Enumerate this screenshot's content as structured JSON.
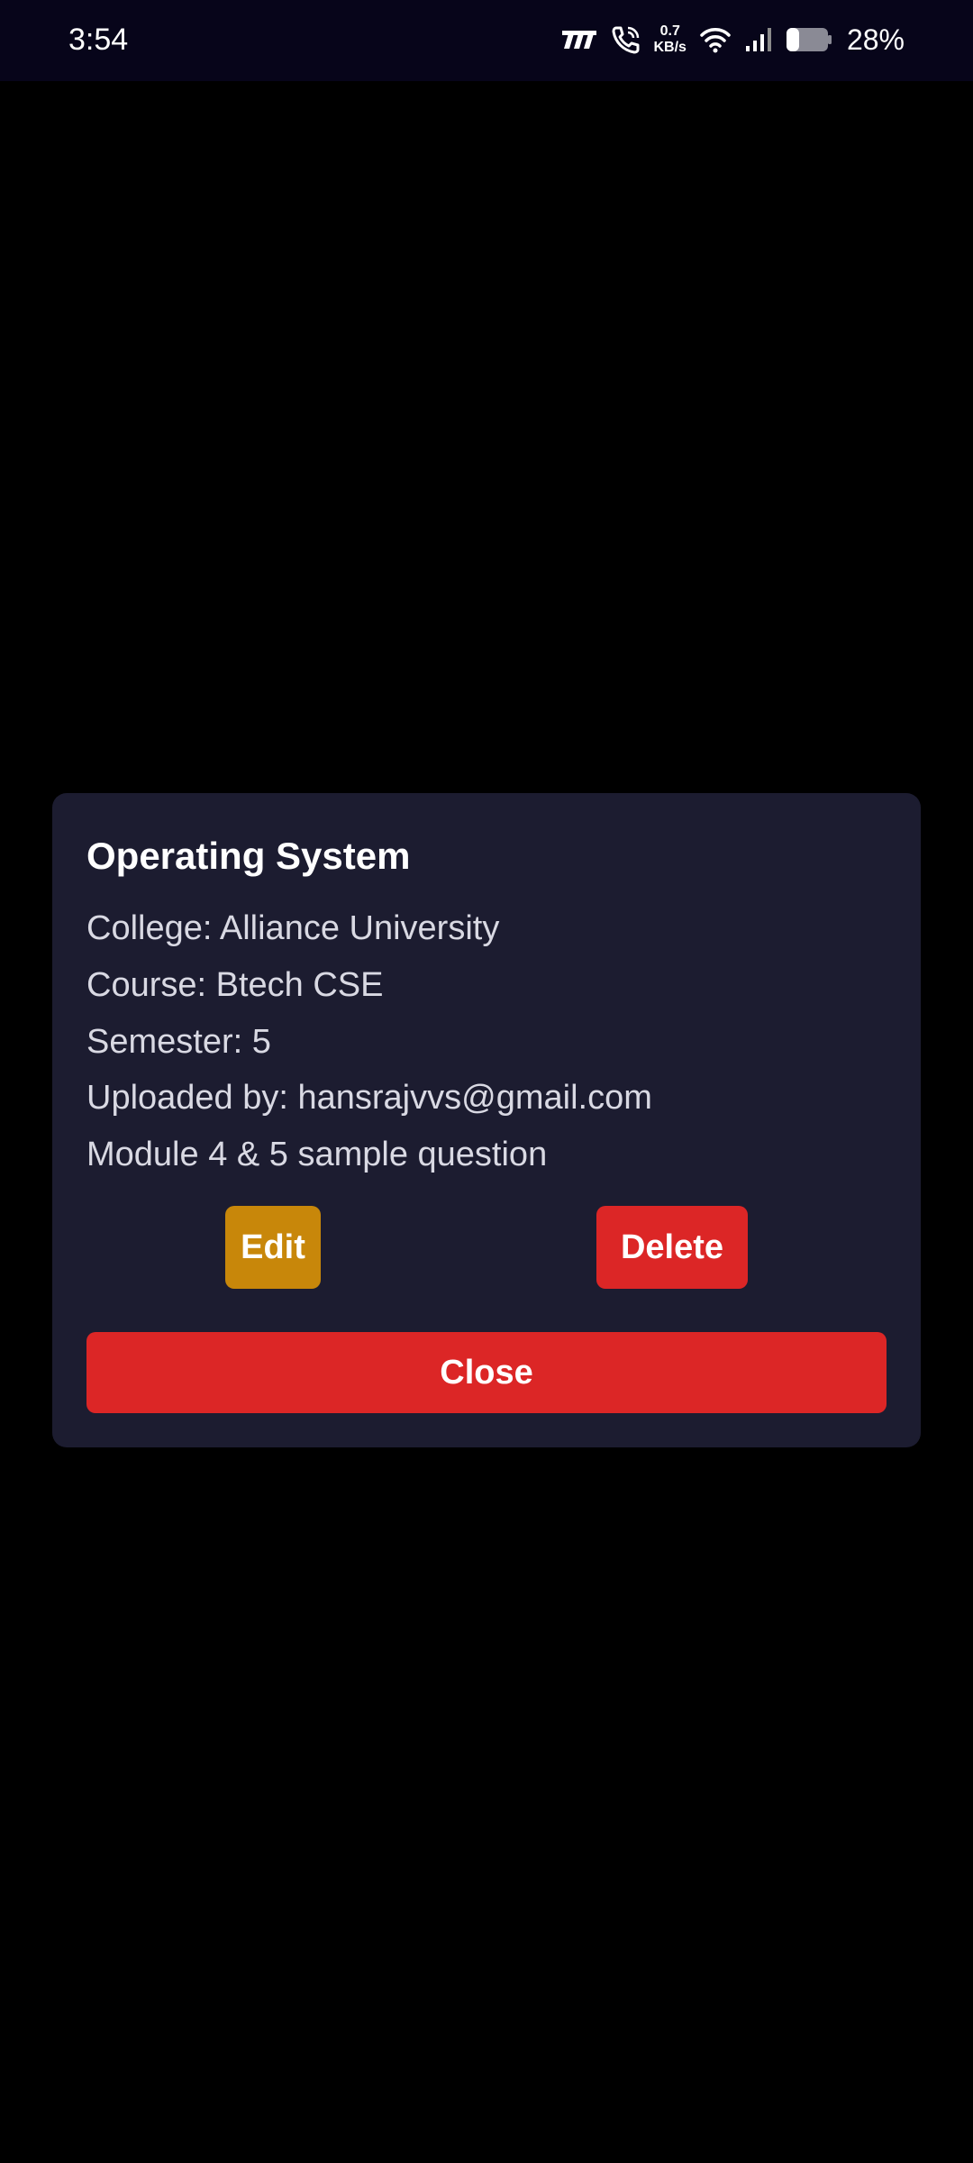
{
  "status_bar": {
    "time": "3:54",
    "net_speed_value": "0.7",
    "net_speed_unit": "KB/s",
    "battery_percent": "28%",
    "icons": [
      "network-logo-icon",
      "wifi-call-icon",
      "wifi-icon",
      "cellular-signal-icon",
      "battery-icon"
    ]
  },
  "dialog": {
    "title": "Operating System",
    "college": "College: Alliance University",
    "course": "Course: Btech CSE",
    "semester": "Semester: 5",
    "uploaded_by": "Uploaded by: hansrajvvs@gmail.com",
    "description": "Module 4 & 5 sample question",
    "edit_label": "Edit",
    "delete_label": "Delete",
    "close_label": "Close"
  },
  "colors": {
    "background": "#000000",
    "status_bar": "#07051a",
    "dialog_background": "#1c1c30",
    "edit_button": "#c8870a",
    "danger_button": "#dc2626",
    "text_primary": "#ffffff",
    "text_secondary": "#d9d9e3"
  }
}
